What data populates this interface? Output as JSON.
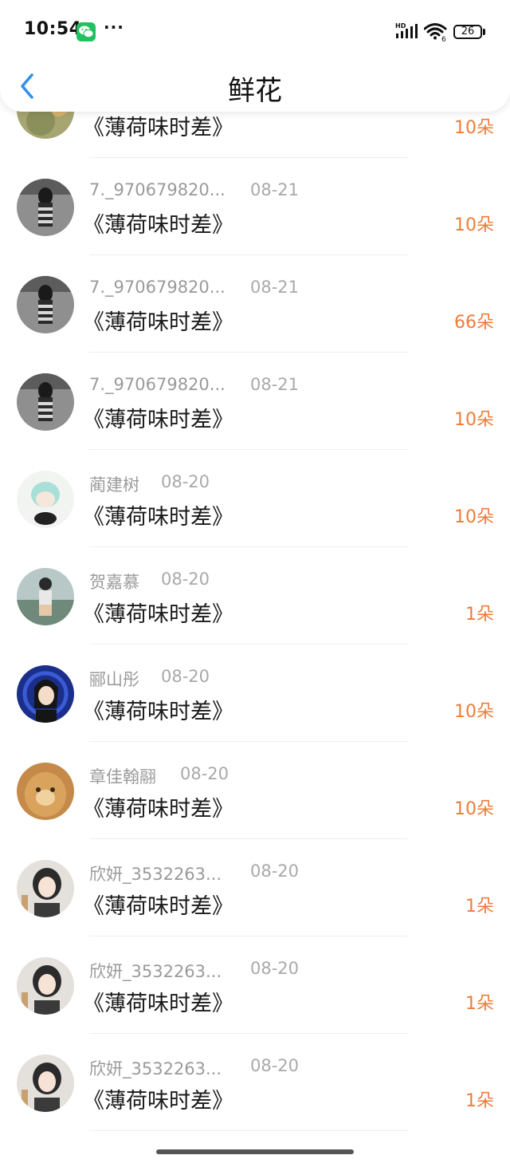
{
  "status_bar": {
    "time": "10:54",
    "more": "···",
    "network": "HD",
    "wifi_label": "6",
    "battery": "26",
    "icons": [
      "wechat-icon",
      "signal-icon",
      "wifi-icon",
      "battery-icon"
    ]
  },
  "header": {
    "title": "鲜花",
    "back_icon": "chevron-left-icon",
    "back_color": "#2e8ff0"
  },
  "colors": {
    "count": "#ee7c3a",
    "name": "#9a9a9a",
    "title": "#1a1a1a"
  },
  "records": [
    {
      "name": "",
      "date": "",
      "title": "《薄荷味时差》",
      "count": "10朵"
    },
    {
      "name": "7._970679820...",
      "date": "08-21",
      "title": "《薄荷味时差》",
      "count": "10朵"
    },
    {
      "name": "7._970679820...",
      "date": "08-21",
      "title": "《薄荷味时差》",
      "count": "66朵"
    },
    {
      "name": "7._970679820...",
      "date": "08-21",
      "title": "《薄荷味时差》",
      "count": "10朵"
    },
    {
      "name": "蔺建树",
      "date": "08-20",
      "title": "《薄荷味时差》",
      "count": "10朵"
    },
    {
      "name": "贺嘉慕",
      "date": "08-20",
      "title": "《薄荷味时差》",
      "count": "1朵"
    },
    {
      "name": "郦山彤",
      "date": "08-20",
      "title": "《薄荷味时差》",
      "count": "10朵"
    },
    {
      "name": "章佳翰翮",
      "date": "08-20",
      "title": "《薄荷味时差》",
      "count": "10朵"
    },
    {
      "name": "欣妍_3532263...",
      "date": "08-20",
      "title": "《薄荷味时差》",
      "count": "1朵"
    },
    {
      "name": "欣妍_3532263...",
      "date": "08-20",
      "title": "《薄荷味时差》",
      "count": "1朵"
    },
    {
      "name": "欣妍_3532263...",
      "date": "08-20",
      "title": "《薄荷味时差》",
      "count": "1朵"
    }
  ]
}
